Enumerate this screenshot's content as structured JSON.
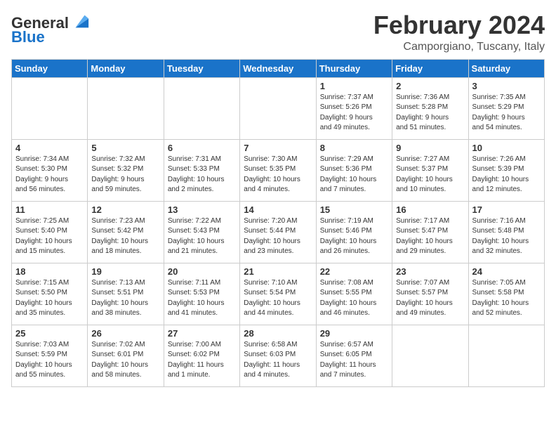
{
  "header": {
    "logo_line1": "General",
    "logo_line2": "Blue",
    "month": "February 2024",
    "location": "Camporgiano, Tuscany, Italy"
  },
  "days_of_week": [
    "Sunday",
    "Monday",
    "Tuesday",
    "Wednesday",
    "Thursday",
    "Friday",
    "Saturday"
  ],
  "weeks": [
    [
      {
        "day": "",
        "info": ""
      },
      {
        "day": "",
        "info": ""
      },
      {
        "day": "",
        "info": ""
      },
      {
        "day": "",
        "info": ""
      },
      {
        "day": "1",
        "info": "Sunrise: 7:37 AM\nSunset: 5:26 PM\nDaylight: 9 hours\nand 49 minutes."
      },
      {
        "day": "2",
        "info": "Sunrise: 7:36 AM\nSunset: 5:28 PM\nDaylight: 9 hours\nand 51 minutes."
      },
      {
        "day": "3",
        "info": "Sunrise: 7:35 AM\nSunset: 5:29 PM\nDaylight: 9 hours\nand 54 minutes."
      }
    ],
    [
      {
        "day": "4",
        "info": "Sunrise: 7:34 AM\nSunset: 5:30 PM\nDaylight: 9 hours\nand 56 minutes."
      },
      {
        "day": "5",
        "info": "Sunrise: 7:32 AM\nSunset: 5:32 PM\nDaylight: 9 hours\nand 59 minutes."
      },
      {
        "day": "6",
        "info": "Sunrise: 7:31 AM\nSunset: 5:33 PM\nDaylight: 10 hours\nand 2 minutes."
      },
      {
        "day": "7",
        "info": "Sunrise: 7:30 AM\nSunset: 5:35 PM\nDaylight: 10 hours\nand 4 minutes."
      },
      {
        "day": "8",
        "info": "Sunrise: 7:29 AM\nSunset: 5:36 PM\nDaylight: 10 hours\nand 7 minutes."
      },
      {
        "day": "9",
        "info": "Sunrise: 7:27 AM\nSunset: 5:37 PM\nDaylight: 10 hours\nand 10 minutes."
      },
      {
        "day": "10",
        "info": "Sunrise: 7:26 AM\nSunset: 5:39 PM\nDaylight: 10 hours\nand 12 minutes."
      }
    ],
    [
      {
        "day": "11",
        "info": "Sunrise: 7:25 AM\nSunset: 5:40 PM\nDaylight: 10 hours\nand 15 minutes."
      },
      {
        "day": "12",
        "info": "Sunrise: 7:23 AM\nSunset: 5:42 PM\nDaylight: 10 hours\nand 18 minutes."
      },
      {
        "day": "13",
        "info": "Sunrise: 7:22 AM\nSunset: 5:43 PM\nDaylight: 10 hours\nand 21 minutes."
      },
      {
        "day": "14",
        "info": "Sunrise: 7:20 AM\nSunset: 5:44 PM\nDaylight: 10 hours\nand 23 minutes."
      },
      {
        "day": "15",
        "info": "Sunrise: 7:19 AM\nSunset: 5:46 PM\nDaylight: 10 hours\nand 26 minutes."
      },
      {
        "day": "16",
        "info": "Sunrise: 7:17 AM\nSunset: 5:47 PM\nDaylight: 10 hours\nand 29 minutes."
      },
      {
        "day": "17",
        "info": "Sunrise: 7:16 AM\nSunset: 5:48 PM\nDaylight: 10 hours\nand 32 minutes."
      }
    ],
    [
      {
        "day": "18",
        "info": "Sunrise: 7:15 AM\nSunset: 5:50 PM\nDaylight: 10 hours\nand 35 minutes."
      },
      {
        "day": "19",
        "info": "Sunrise: 7:13 AM\nSunset: 5:51 PM\nDaylight: 10 hours\nand 38 minutes."
      },
      {
        "day": "20",
        "info": "Sunrise: 7:11 AM\nSunset: 5:53 PM\nDaylight: 10 hours\nand 41 minutes."
      },
      {
        "day": "21",
        "info": "Sunrise: 7:10 AM\nSunset: 5:54 PM\nDaylight: 10 hours\nand 44 minutes."
      },
      {
        "day": "22",
        "info": "Sunrise: 7:08 AM\nSunset: 5:55 PM\nDaylight: 10 hours\nand 46 minutes."
      },
      {
        "day": "23",
        "info": "Sunrise: 7:07 AM\nSunset: 5:57 PM\nDaylight: 10 hours\nand 49 minutes."
      },
      {
        "day": "24",
        "info": "Sunrise: 7:05 AM\nSunset: 5:58 PM\nDaylight: 10 hours\nand 52 minutes."
      }
    ],
    [
      {
        "day": "25",
        "info": "Sunrise: 7:03 AM\nSunset: 5:59 PM\nDaylight: 10 hours\nand 55 minutes."
      },
      {
        "day": "26",
        "info": "Sunrise: 7:02 AM\nSunset: 6:01 PM\nDaylight: 10 hours\nand 58 minutes."
      },
      {
        "day": "27",
        "info": "Sunrise: 7:00 AM\nSunset: 6:02 PM\nDaylight: 11 hours\nand 1 minute."
      },
      {
        "day": "28",
        "info": "Sunrise: 6:58 AM\nSunset: 6:03 PM\nDaylight: 11 hours\nand 4 minutes."
      },
      {
        "day": "29",
        "info": "Sunrise: 6:57 AM\nSunset: 6:05 PM\nDaylight: 11 hours\nand 7 minutes."
      },
      {
        "day": "",
        "info": ""
      },
      {
        "day": "",
        "info": ""
      }
    ]
  ]
}
